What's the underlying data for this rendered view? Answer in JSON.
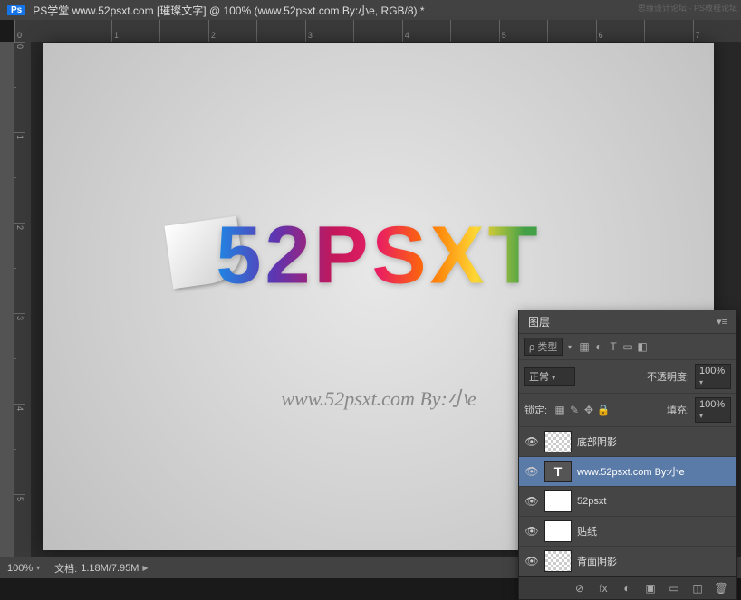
{
  "titlebar": {
    "app": "Ps",
    "doc_title": "PS学堂  www.52psxt.com [璀璨文字] @ 100% (www.52psxt.com By:小e, RGB/8) *",
    "watermark_right_1": "思缘设计论坛",
    "watermark_right_2": "PS教程论坛"
  },
  "rulers": {
    "top": [
      "0",
      "",
      "1",
      "",
      "2",
      "",
      "3",
      "",
      "4",
      "",
      "5",
      "",
      "6",
      "",
      "7"
    ],
    "left": [
      "0",
      "",
      "1",
      "",
      "2",
      "",
      "3",
      "",
      "4",
      "",
      "5"
    ]
  },
  "canvas": {
    "main_text": "52PSXT",
    "sub_text": "www.52psxt.com  By:小e"
  },
  "status": {
    "zoom": "100%",
    "doc_label": "文档:",
    "doc_value": "1.18M/7.95M"
  },
  "layers_panel": {
    "tab_label": "图层",
    "search_icon": "ρ",
    "type_label": "类型",
    "filter_icons": [
      "▦",
      "◐",
      "T",
      "▭",
      "◧"
    ],
    "blend_mode": "正常",
    "opacity_label": "不透明度:",
    "opacity_value": "100%",
    "lock_label": "锁定:",
    "lock_icons": [
      "▦",
      "✎",
      "✥",
      "🔒"
    ],
    "fill_label": "填充:",
    "fill_value": "100%",
    "layers": [
      {
        "name": "底部阴影",
        "thumb": "checker",
        "selected": false
      },
      {
        "name": "www.52psxt.com By:小e",
        "thumb": "T",
        "selected": true
      },
      {
        "name": "52psxt",
        "thumb": "img",
        "selected": false
      },
      {
        "name": "贴纸",
        "thumb": "img",
        "selected": false
      },
      {
        "name": "背面阴影",
        "thumb": "checker",
        "selected": false
      }
    ],
    "footer_icons": [
      "⊘",
      "fx",
      "◐",
      "▣",
      "▭",
      "◫",
      "🗑"
    ]
  }
}
